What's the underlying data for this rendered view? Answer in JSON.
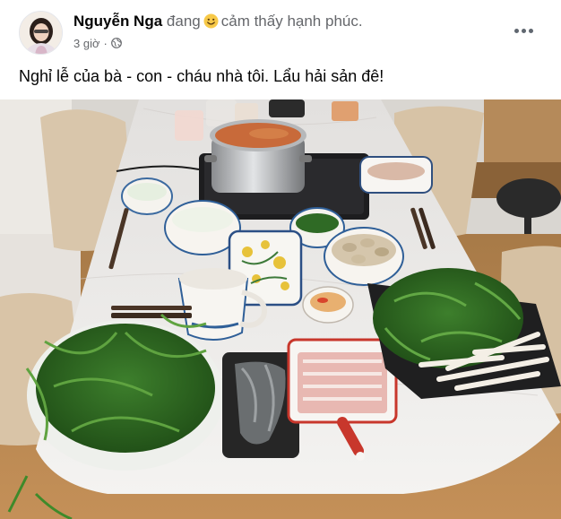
{
  "post": {
    "author": "Nguyễn Nga",
    "status_prefix": "đang",
    "status_feeling": "cảm thấy hạnh phúc.",
    "time": "3 giờ",
    "separator": "·",
    "text": "Nghỉ lễ của bà - con - cháu nhà tôi. Lẩu hải sản đê!",
    "icons": {
      "emoji": "smiling-face-icon",
      "privacy": "globe-icon",
      "more": "more-options-icon"
    }
  },
  "colors": {
    "text_primary": "#050505",
    "text_secondary": "#65676b"
  }
}
